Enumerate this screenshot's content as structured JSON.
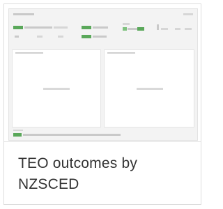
{
  "tile": {
    "title": "TEO outcomes by NZSCED"
  }
}
